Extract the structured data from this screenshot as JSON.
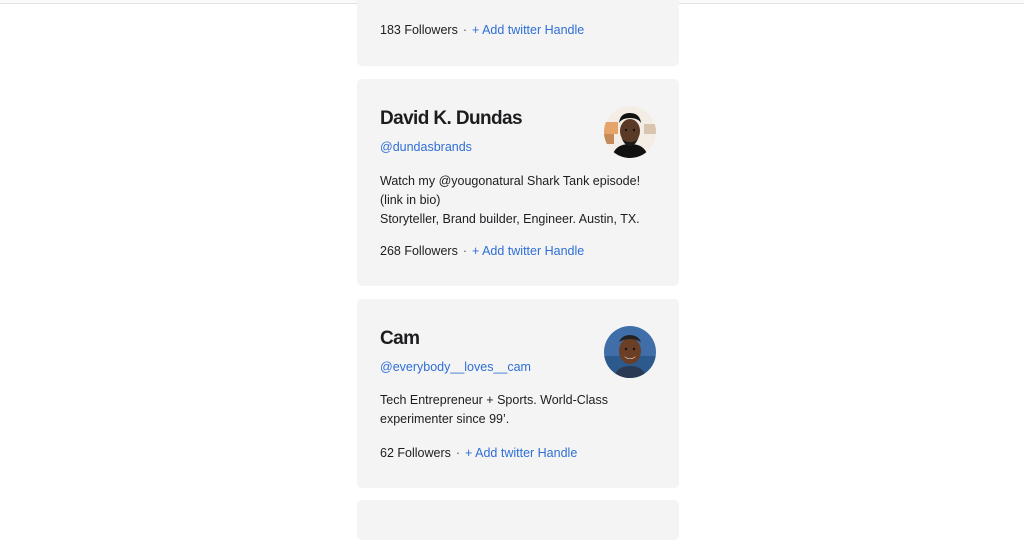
{
  "cards": [
    {
      "followers": "183 Followers",
      "separator": "·",
      "add_handle": "+ Add twitter Handle"
    },
    {
      "name": "David K. Dundas",
      "handle": "@dundasbrands",
      "bio": [
        "Watch my @yougonatural Shark Tank episode!",
        "(link in bio)",
        "Storyteller, Brand builder, Engineer. Austin, TX."
      ],
      "followers": "268 Followers",
      "separator": "·",
      "add_handle": "+ Add twitter Handle"
    },
    {
      "name": "Cam",
      "handle": "@everybody__loves__cam",
      "bio": [
        "Tech Entrepreneur + Sports. World-Class",
        "experimenter since 99’."
      ],
      "followers": "62 Followers",
      "separator": "·",
      "add_handle": "+ Add twitter Handle"
    }
  ],
  "colors": {
    "card_bg": "#f4f4f5",
    "link": "#2f6fd6",
    "text": "#1d1d1f"
  }
}
